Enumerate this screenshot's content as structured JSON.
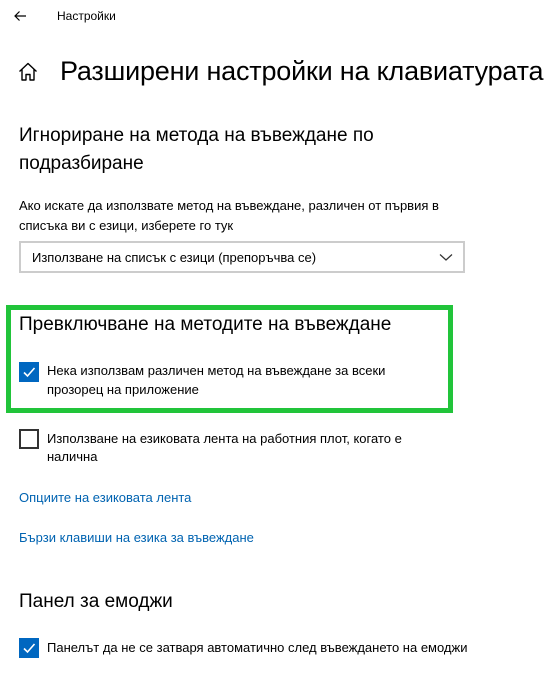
{
  "titlebar": {
    "title": "Настройки"
  },
  "page": {
    "title": "Разширени настройки на клавиатурата"
  },
  "input_method_override": {
    "heading_line1": "Игнориране на метода на въвеждане по",
    "heading_line2": "подразбиране",
    "description_line1": "Ако искате да използвате метод на въвеждане, различен от първия в",
    "description_line2": "списъка ви с езици, изберете го тук",
    "dropdown_value": "Използване на списък с езици (препоръчва се)"
  },
  "switching": {
    "heading": "Превключване на методите на въвеждане",
    "per_app_checkbox": {
      "checked": true,
      "label_line1": "Нека използвам различен метод на въвеждане за всеки",
      "label_line2": "прозорец на приложение"
    },
    "language_bar_checkbox": {
      "checked": false,
      "label_line1": "Използване на езиковата лента на работния плот, когато е",
      "label_line2": "налична"
    },
    "language_bar_options_link": "Опциите на езиковата лента",
    "hotkeys_link": "Бързи клавиши на езика за въвеждане"
  },
  "emoji_panel": {
    "heading": "Панел за емоджи",
    "checkbox": {
      "checked": true,
      "label": "Панелът да не се затваря автоматично след въвеждането на емоджи"
    }
  },
  "colors": {
    "accent": "#0067c0",
    "link": "#0063b1",
    "highlight": "#21c43a"
  }
}
